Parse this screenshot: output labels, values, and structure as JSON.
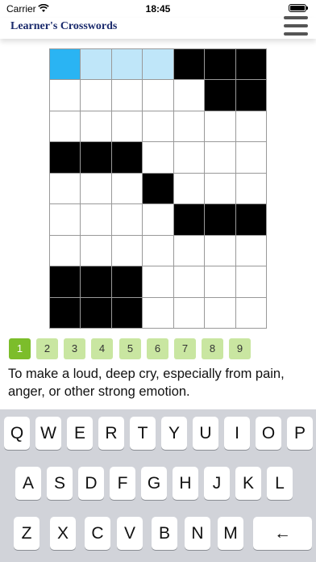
{
  "status_bar": {
    "carrier": "Carrier",
    "time": "18:45"
  },
  "header": {
    "title": "Learner's Crosswords",
    "menu_icon": "hamburger-menu-icon"
  },
  "grid": {
    "rows": 9,
    "cols": 7,
    "cells": [
      [
        "active",
        "highlight",
        "highlight",
        "highlight",
        "black",
        "black",
        "black"
      ],
      [
        "white",
        "white",
        "white",
        "white",
        "white",
        "black",
        "black"
      ],
      [
        "white",
        "white",
        "white",
        "white",
        "white",
        "white",
        "white"
      ],
      [
        "black",
        "black",
        "black",
        "white",
        "white",
        "white",
        "white"
      ],
      [
        "white",
        "white",
        "white",
        "black",
        "white",
        "white",
        "white"
      ],
      [
        "white",
        "white",
        "white",
        "white",
        "black",
        "black",
        "black"
      ],
      [
        "white",
        "white",
        "white",
        "white",
        "white",
        "white",
        "white"
      ],
      [
        "black",
        "black",
        "black",
        "white",
        "white",
        "white",
        "white"
      ],
      [
        "black",
        "black",
        "black",
        "white",
        "white",
        "white",
        "white"
      ]
    ]
  },
  "clue_numbers": [
    "1",
    "2",
    "3",
    "4",
    "5",
    "6",
    "7",
    "8",
    "9"
  ],
  "active_clue_index": 0,
  "clue_text": "To make a loud, deep cry, especially from pain, anger, or other strong emotion.",
  "keyboard": {
    "rows": [
      [
        "Q",
        "W",
        "E",
        "R",
        "T",
        "Y",
        "U",
        "I",
        "O",
        "P"
      ],
      [
        "A",
        "S",
        "D",
        "F",
        "G",
        "H",
        "J",
        "K",
        "L"
      ],
      [
        "Z",
        "X",
        "C",
        "V",
        "B",
        "N",
        "M"
      ]
    ],
    "backspace_label": "←"
  },
  "colors": {
    "active_cell": "#2ab4f3",
    "highlight_cell": "#bfe6f9",
    "active_clue": "#7cbd2b",
    "clue_chip": "#c9e6a1",
    "title": "#1a2a6c"
  }
}
